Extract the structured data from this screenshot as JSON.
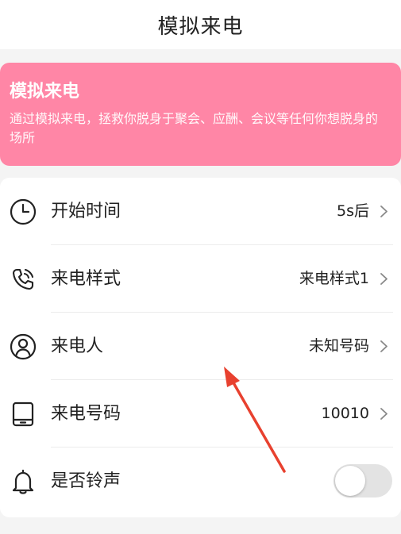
{
  "header": {
    "title": "模拟来电"
  },
  "banner": {
    "title": "模拟来电",
    "description": "通过模拟来电，拯救你脱身于聚会、应酬、会议等任何你想脱身的场所",
    "color": "#ff86a6"
  },
  "settings": {
    "items": [
      {
        "label": "开始时间",
        "value": "5s后",
        "icon": "clock-icon"
      },
      {
        "label": "来电样式",
        "value": "来电样式1",
        "icon": "phone-call-icon"
      },
      {
        "label": "来电人",
        "value": "未知号码",
        "icon": "person-icon"
      },
      {
        "label": "来电号码",
        "value": "10010",
        "icon": "tablet-icon"
      },
      {
        "label": "是否铃声",
        "icon": "bell-icon",
        "toggle_on": false
      }
    ]
  },
  "annotation": {
    "arrow_color": "#e8412f"
  }
}
